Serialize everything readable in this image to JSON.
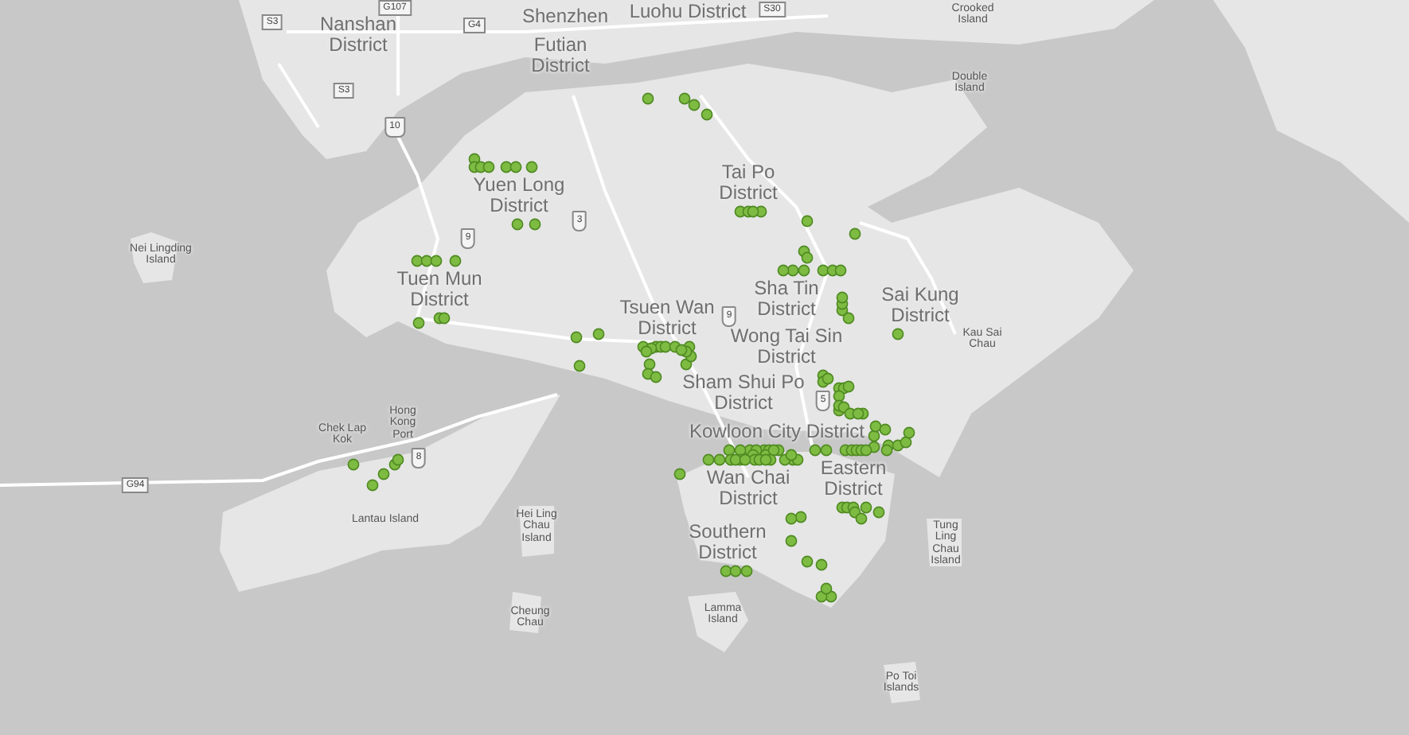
{
  "map": {
    "places": [
      {
        "name": "Nanshan District",
        "kind": "district"
      },
      {
        "name": "Shenzhen",
        "kind": "district"
      },
      {
        "name": "Futian District",
        "kind": "district"
      },
      {
        "name": "Luohu District",
        "kind": "district"
      },
      {
        "name": "Yuen Long District",
        "kind": "district"
      },
      {
        "name": "Tuen Mun District",
        "kind": "district"
      },
      {
        "name": "Tai Po District",
        "kind": "district"
      },
      {
        "name": "Tsuen Wan District",
        "kind": "district"
      },
      {
        "name": "Sha Tin District",
        "kind": "district"
      },
      {
        "name": "Sai Kung District",
        "kind": "district"
      },
      {
        "name": "Wong Tai Sin District",
        "kind": "district"
      },
      {
        "name": "Sham Shui Po District",
        "kind": "district"
      },
      {
        "name": "Kowloon City District",
        "kind": "district"
      },
      {
        "name": "Wan Chai District",
        "kind": "district"
      },
      {
        "name": "Eastern District",
        "kind": "district"
      },
      {
        "name": "Southern District",
        "kind": "district"
      },
      {
        "name": "Crooked Island",
        "kind": "island"
      },
      {
        "name": "Double Island",
        "kind": "island"
      },
      {
        "name": "Nei Lingding Island",
        "kind": "island"
      },
      {
        "name": "Chek Lap Kok",
        "kind": "island"
      },
      {
        "name": "Hong Kong Port",
        "kind": "island"
      },
      {
        "name": "Lantau Island",
        "kind": "island"
      },
      {
        "name": "Hei Ling Chau Island",
        "kind": "island"
      },
      {
        "name": "Cheung Chau",
        "kind": "island"
      },
      {
        "name": "Kau Sai Chau",
        "kind": "island"
      },
      {
        "name": "Tung Ling Chau Island",
        "kind": "island"
      },
      {
        "name": "Lamma Island",
        "kind": "island"
      },
      {
        "name": "Po Toi Islands",
        "kind": "island"
      }
    ],
    "road_shields": [
      {
        "label": "G107",
        "kind": "expressway"
      },
      {
        "label": "S3",
        "kind": "expressway"
      },
      {
        "label": "G4",
        "kind": "expressway"
      },
      {
        "label": "S30",
        "kind": "expressway"
      },
      {
        "label": "S3",
        "kind": "expressway"
      },
      {
        "label": "10",
        "kind": "route"
      },
      {
        "label": "3",
        "kind": "route"
      },
      {
        "label": "9",
        "kind": "route"
      },
      {
        "label": "9",
        "kind": "route"
      },
      {
        "label": "5",
        "kind": "route"
      },
      {
        "label": "8",
        "kind": "route"
      },
      {
        "label": "G94",
        "kind": "expressway"
      }
    ]
  }
}
